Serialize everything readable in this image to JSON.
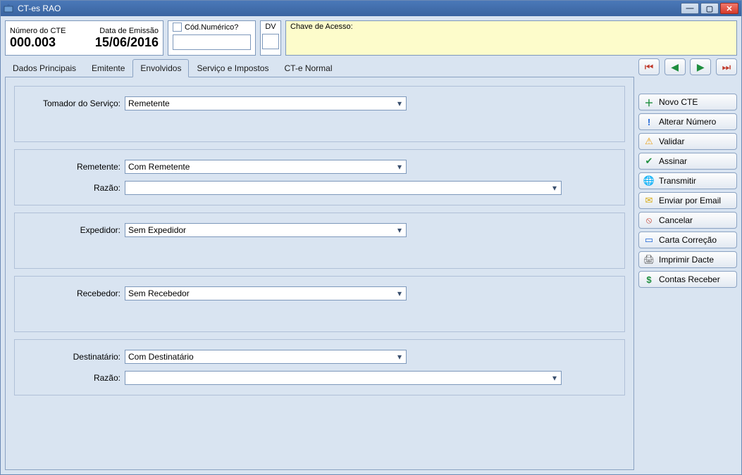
{
  "window": {
    "title": "CT-es RAO"
  },
  "header": {
    "numero_label": "Número do CTE",
    "numero_value": "000.003",
    "data_label": "Data de Emissão",
    "data_value": "15/06/2016",
    "codnum_label": "Cód.Numérico?",
    "codnum_value": "",
    "dv_label": "DV",
    "dv_value": "",
    "chave_label": "Chave de Acesso:",
    "chave_value": ""
  },
  "tabs": [
    {
      "label": "Dados Principais"
    },
    {
      "label": "Emitente"
    },
    {
      "label": "Envolvidos"
    },
    {
      "label": "Serviço e Impostos"
    },
    {
      "label": "CT-e Normal"
    }
  ],
  "form": {
    "tomador_label": "Tomador do Serviço:",
    "tomador_value": "Remetente",
    "remetente_label": "Remetente:",
    "remetente_value": "Com Remetente",
    "remetente_razao_label": "Razão:",
    "remetente_razao_value": "",
    "expedidor_label": "Expedidor:",
    "expedidor_value": "Sem Expedidor",
    "recebedor_label": "Recebedor:",
    "recebedor_value": "Sem Recebedor",
    "destinatario_label": "Destinatário:",
    "destinatario_value": "Com Destinatário",
    "destinatario_razao_label": "Razão:",
    "destinatario_razao_value": ""
  },
  "side": {
    "novo": "Novo CTE",
    "alterar": "Alterar Número",
    "validar": "Validar",
    "assinar": "Assinar",
    "transmitir": "Transmitir",
    "enviar": "Enviar por Email",
    "cancelar": "Cancelar",
    "carta": "Carta Correção",
    "imprimir": "Imprimir Dacte",
    "contas": "Contas Receber"
  }
}
